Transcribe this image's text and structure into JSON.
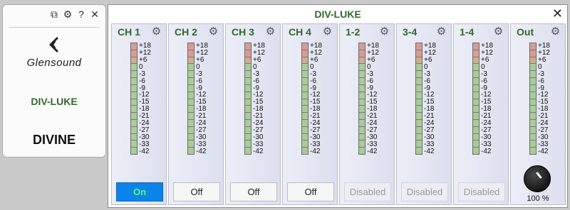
{
  "side_panel": {
    "tools": [
      {
        "name": "copy-icon",
        "glyph": "⧉"
      },
      {
        "name": "gear-icon",
        "glyph": "⚙"
      },
      {
        "name": "help-icon",
        "glyph": "?"
      },
      {
        "name": "close-icon",
        "glyph": "✕"
      }
    ],
    "logo_text": "Glensound",
    "device": "DIV-LUKE",
    "product": "DIVINE"
  },
  "mixer": {
    "title": "DIV-LUKE",
    "close_glyph": "✕",
    "scale": [
      "+18",
      "+12",
      "+6",
      "0",
      "-3",
      "-6",
      "-9",
      "-12",
      "-15",
      "-18",
      "-21",
      "-24",
      "-27",
      "-30",
      "-33",
      "-42"
    ],
    "gear_glyph": "⚙",
    "channels": [
      {
        "name": "CH 1",
        "button": "On",
        "state": "on"
      },
      {
        "name": "CH 2",
        "button": "Off",
        "state": "off"
      },
      {
        "name": "CH 3",
        "button": "Off",
        "state": "off"
      },
      {
        "name": "CH 4",
        "button": "Off",
        "state": "off"
      },
      {
        "name": "1-2",
        "button": "Disabled",
        "state": "disabled"
      },
      {
        "name": "3-4",
        "button": "Disabled",
        "state": "disabled"
      },
      {
        "name": "1-4",
        "button": "Disabled",
        "state": "disabled"
      },
      {
        "name": "Out",
        "knob_value": "100 %",
        "state": "knob"
      }
    ]
  },
  "colors": {
    "accent_green": "#2f6a2b",
    "on_blue": "#0a84e8",
    "on_text": "#59ff68",
    "meter_red": "#d99c94",
    "meter_amber": "#c9b090",
    "meter_green": "#a9cc98"
  }
}
